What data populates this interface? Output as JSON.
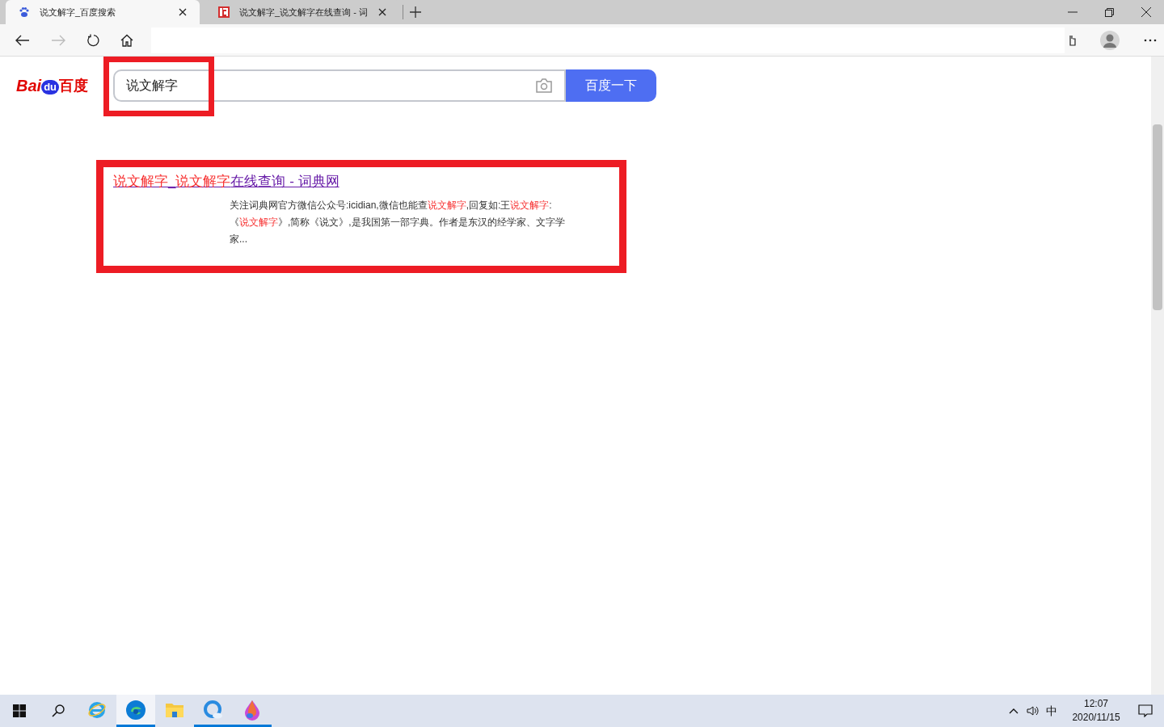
{
  "tabs": [
    {
      "title": "说文解字_百度搜索",
      "kind": "baidu",
      "selected": true
    },
    {
      "title": "说文解字_说文解字在线查询 - 词",
      "kind": "dictionary",
      "selected": false
    }
  ],
  "search": {
    "logo": [
      "Bai",
      "du",
      "百度"
    ],
    "value": "说文解字",
    "button": "百度一下"
  },
  "result": {
    "title": [
      {
        "text": "说文解字",
        "highlight": true
      },
      {
        "text": "_",
        "highlight": false
      },
      {
        "text": "说文解字",
        "highlight": true
      },
      {
        "text": "在线查询 - 词典网",
        "highlight": false
      }
    ],
    "snippet": [
      {
        "text": "关注词典网官方微信公众号:icidian,微信也能查",
        "highlight": false
      },
      {
        "text": "说文解字",
        "highlight": true
      },
      {
        "text": ",回复如:王",
        "highlight": false
      },
      {
        "text": "说文解字",
        "highlight": true
      },
      {
        "text": ":《",
        "highlight": false
      },
      {
        "text": "说文解字",
        "highlight": true
      },
      {
        "text": "》,简称《说文》,是我国第一部字典。作者是东汉的经学家、文字学家...",
        "highlight": false
      }
    ]
  },
  "taskbar": {
    "apps": [
      {
        "kind": "ie",
        "running": false,
        "selected": false
      },
      {
        "kind": "edge",
        "running": true,
        "selected": true
      },
      {
        "kind": "folder",
        "running": false,
        "selected": false
      },
      {
        "kind": "browser",
        "running": true,
        "selected": false
      },
      {
        "kind": "paint",
        "running": true,
        "selected": false
      }
    ],
    "ime": "中",
    "time": "12:07",
    "date": "2020/11/15"
  }
}
